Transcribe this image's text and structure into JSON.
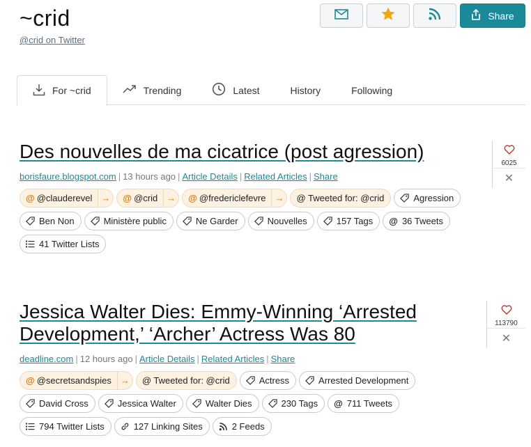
{
  "site": {
    "title": "~crid",
    "subtitle": "@crid on Twitter"
  },
  "actions": {
    "share_label": "Share",
    "icons": [
      "mail-icon",
      "star-icon",
      "rss-icon",
      "share-icon"
    ],
    "star_color": "#f3a512",
    "accent": "#1a8a9a"
  },
  "tabs": [
    {
      "label": "For ~crid",
      "icon": "download-icon",
      "active": true
    },
    {
      "label": "Trending",
      "icon": "trending-icon"
    },
    {
      "label": "Latest",
      "icon": "clock-icon"
    },
    {
      "label": "History"
    },
    {
      "label": "Following"
    }
  ],
  "articles": [
    {
      "title": "Des nouvelles de ma cicatrice (post agression)",
      "source": "borisfaure.blogspot.com",
      "time": "13 hours ago",
      "links": [
        "Article Details",
        "Related Articles",
        "Share"
      ],
      "likes": "6025",
      "mentions": [
        "@clauderevel",
        "@crid",
        "@fredericlefevre"
      ],
      "tweeted_for": "@ Tweeted for: @crid",
      "tags": [
        "Agression",
        "Ben Non",
        "Ministère public",
        "Ne Garder",
        "Nouvelles",
        "157 Tags"
      ],
      "tweets": "36 Tweets",
      "lists": "41 Twitter Lists"
    },
    {
      "title": "Jessica Walter Dies: Emmy-Winning ‘Arrested Development,’ ‘Archer’ Actress Was 80",
      "source": "deadline.com",
      "time": "12 hours ago",
      "links": [
        "Article Details",
        "Related Articles",
        "Share"
      ],
      "likes": "113790",
      "mentions": [
        "@secretsandspies"
      ],
      "tweeted_for": "@ Tweeted for: @crid",
      "tags": [
        "Actress",
        "Arrested Development",
        "David Cross",
        "Jessica Walter",
        "Walter Dies",
        "230 Tags"
      ],
      "tweets": "711 Tweets",
      "lists": "794 Twitter Lists",
      "linking_sites": "127 Linking Sites",
      "feeds": "2 Feeds"
    }
  ]
}
